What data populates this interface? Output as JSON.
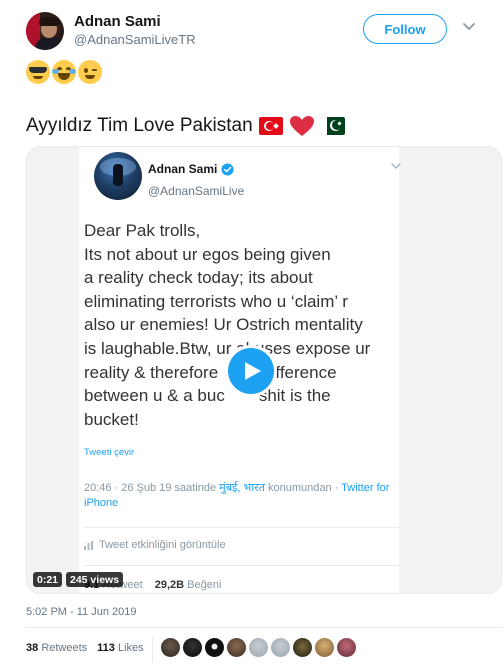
{
  "author": {
    "name": "Adnan Sami",
    "handle": "@AdnanSamiLiveTR",
    "follow_label": "Follow"
  },
  "emojis": [
    "smiling-face-with-sunglasses",
    "face-with-tears-of-joy",
    "winking-face"
  ],
  "tweet": {
    "text": "Ayyıldız Tim Love Pakistan",
    "trailing_icons": [
      "turkey-flag",
      "red-heart",
      "pakistan-flag"
    ]
  },
  "embedded": {
    "name": "Adnan Sami",
    "handle": "@AdnanSamiLive",
    "body_lines": [
      "Dear Pak trolls,",
      "Its not about ur egos being given",
      "a reality check today; its about",
      "eliminating terrorists who u ‘claim’ r",
      "also ur enemies! Ur Ostrich mentality",
      "is laughable.Btw, ur abuses expose ur",
      "reality & therefore",
      "difference",
      "between u & a buc",
      "shit is the",
      "bucket!"
    ],
    "translate": "Tweeti çevir",
    "meta_prefix": "20:46 · 26 Şub 19 saatinde ",
    "meta_place": "मुंबई, भारत",
    "meta_middle": " konumundan · ",
    "meta_client": "Twitter for iPhone",
    "activity": "Tweet etkinliğini görüntüle",
    "retweets_value": "9.1",
    "retweets_label": "Retweet",
    "likes_value": "29,2B",
    "likes_label": "Beğeni"
  },
  "video": {
    "duration": "0:21",
    "views": "245 views"
  },
  "timestamp": "5:02 PM - 11 Jun 2019",
  "stats": {
    "retweets_count": "38",
    "retweets_label": "Retweets",
    "likes_count": "113",
    "likes_label": "Likes"
  },
  "colors": {
    "accent": "#1da1f2",
    "text": "#14171a",
    "muted": "#657786"
  }
}
